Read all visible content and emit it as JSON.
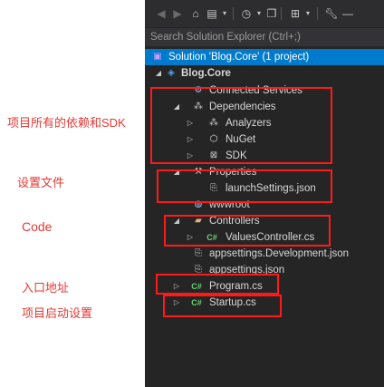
{
  "annotations": {
    "deps": "项目所有的依赖和SDK",
    "config": "设置文件",
    "code": "Code",
    "entry": "入口地址",
    "startup": "项目启动设置"
  },
  "search": {
    "placeholder": "Search Solution Explorer (Ctrl+;)"
  },
  "toolbar": {
    "icons": [
      "back-icon",
      "forward-icon",
      "home-icon",
      "switch-views-icon",
      "history-icon",
      "collapse-all-icon",
      "show-all-files-icon",
      "properties-wrench-icon",
      "pin-icon"
    ]
  },
  "tree": {
    "solution": "Solution 'Blog.Core' (1 project)",
    "project": "Blog.Core",
    "connected_services": "Connected Services",
    "dependencies": "Dependencies",
    "analyzers": "Analyzers",
    "nuget": "NuGet",
    "sdk": "SDK",
    "properties": "Properties",
    "launch_settings": "launchSettings.json",
    "wwwroot": "wwwroot",
    "controllers": "Controllers",
    "values_controller": "ValuesController.cs",
    "appsettings_dev": "appsettings.Development.json",
    "appsettings": "appsettings.json",
    "program": "Program.cs",
    "startup": "Startup.cs"
  },
  "colors": {
    "panel_bg": "#252526",
    "selection": "#007acc",
    "annotation_red": "#e53935",
    "csharp_green": "#6bd36b",
    "folder_yellow": "#dcb67a"
  }
}
